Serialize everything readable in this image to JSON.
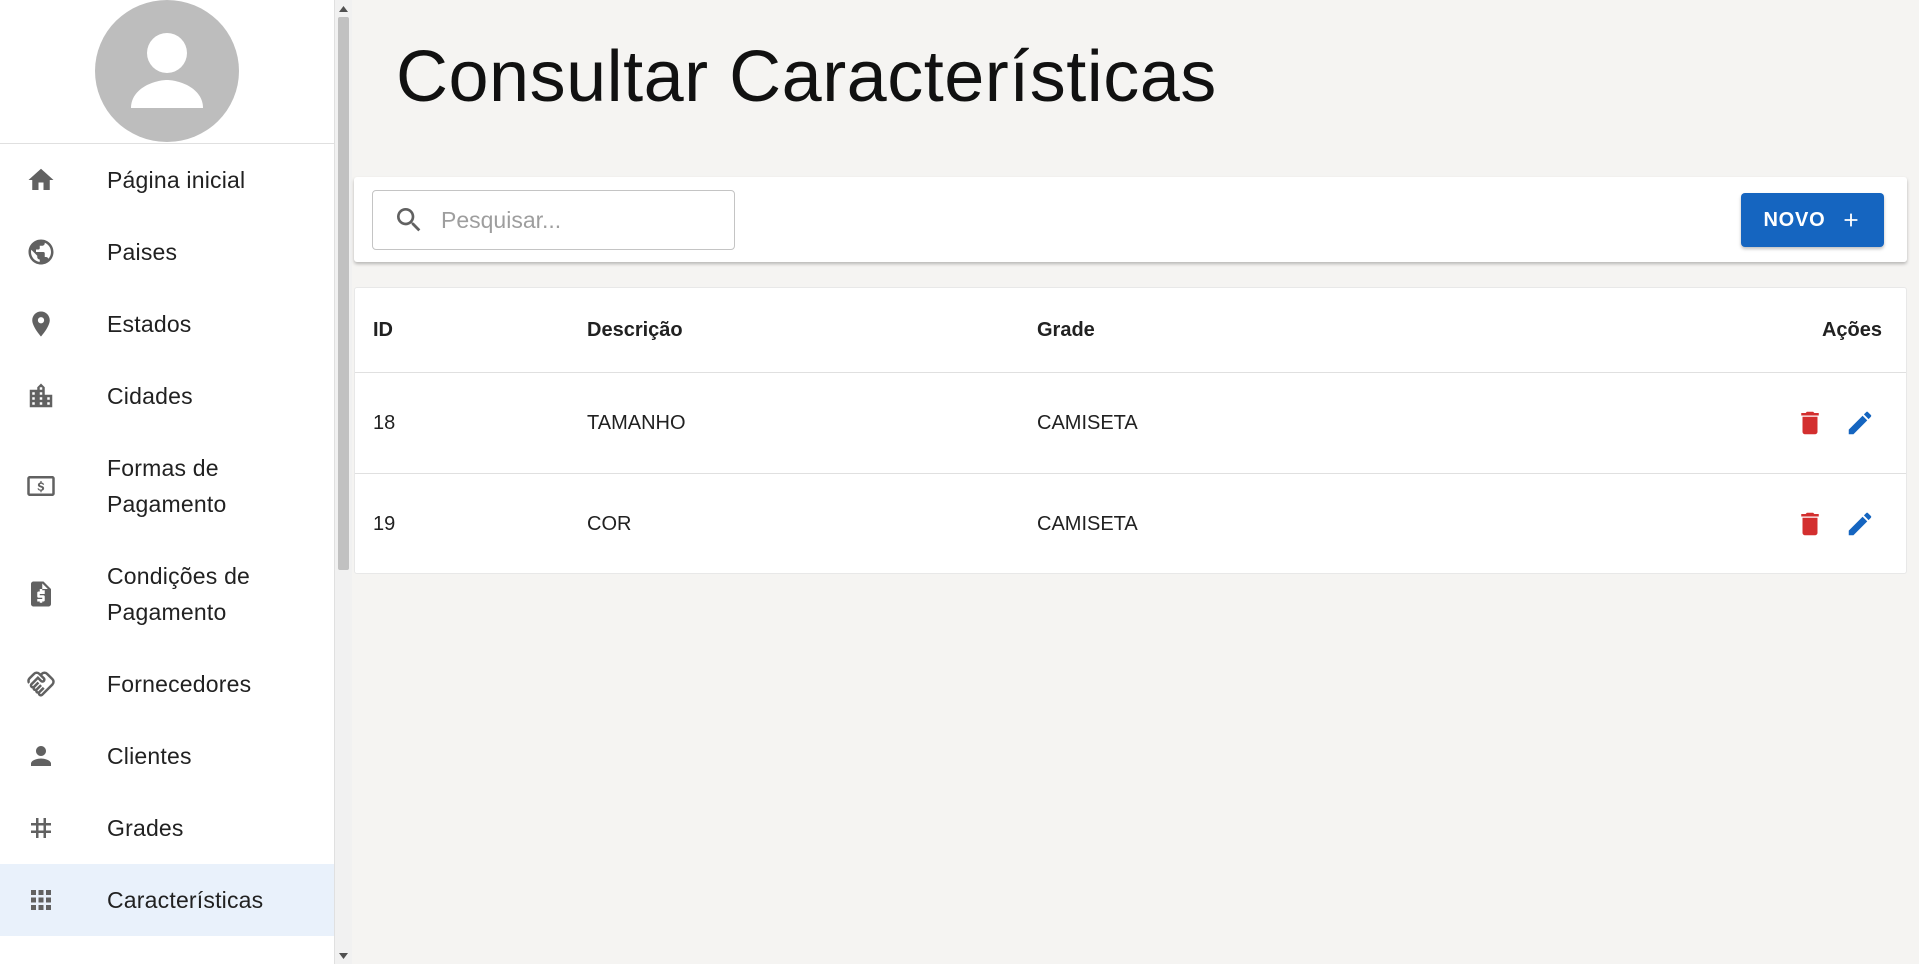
{
  "sidebar": {
    "items": [
      {
        "label": "Página inicial",
        "icon": "home-icon"
      },
      {
        "label": "Paises",
        "icon": "globe-icon"
      },
      {
        "label": "Estados",
        "icon": "location-pin-icon"
      },
      {
        "label": "Cidades",
        "icon": "city-icon"
      },
      {
        "label": "Formas de Pagamento",
        "icon": "money-icon"
      },
      {
        "label": "Condições de Pagamento",
        "icon": "request-quote-icon"
      },
      {
        "label": "Fornecedores",
        "icon": "handshake-icon"
      },
      {
        "label": "Clientes",
        "icon": "person-icon"
      },
      {
        "label": "Grades",
        "icon": "grid-hash-icon"
      },
      {
        "label": "Características",
        "icon": "apps-icon"
      }
    ],
    "active_item": "Características"
  },
  "page": {
    "title": "Consultar Características"
  },
  "toolbar": {
    "search_placeholder": "Pesquisar...",
    "search_value": "",
    "new_label": "NOVO"
  },
  "table": {
    "columns": [
      "ID",
      "Descrição",
      "Grade",
      "Ações"
    ],
    "rows": [
      {
        "id": "18",
        "descricao": "TAMANHO",
        "grade": "CAMISETA"
      },
      {
        "id": "19",
        "descricao": "COR",
        "grade": "CAMISETA"
      }
    ]
  },
  "colors": {
    "primary": "#1565c0",
    "danger": "#d32f2f",
    "active_nav_bg": "#e9f1fb",
    "icon_gray": "#616161",
    "page_bg": "#f5f4f2"
  }
}
